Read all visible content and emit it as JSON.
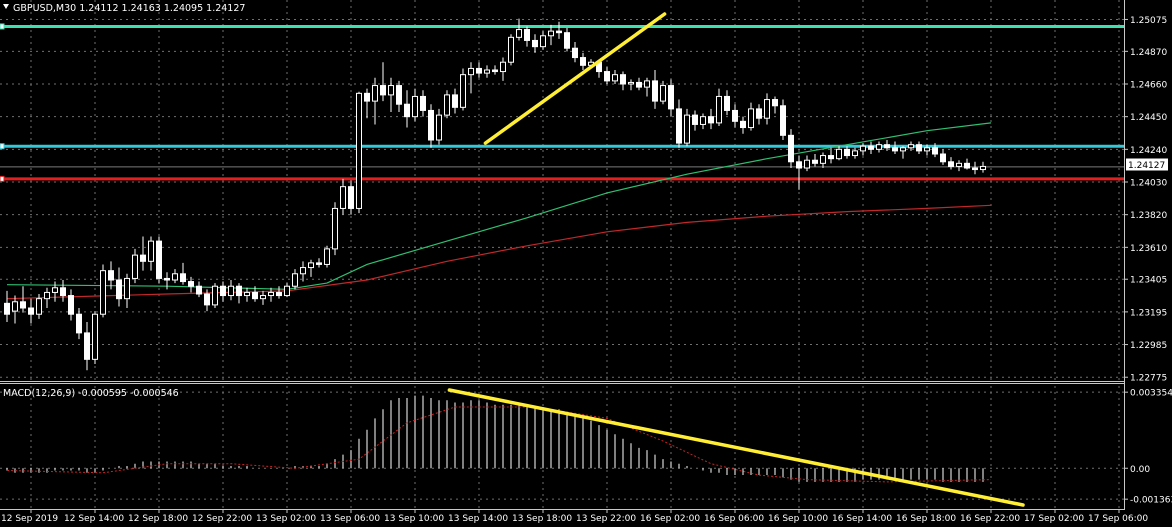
{
  "header": {
    "symbol_info": "GBPUSD,M30  1.24112 1.24163 1.24095 1.24127",
    "collapse_icon": "triangle-down-icon"
  },
  "macd": {
    "label": "MACD(12,26,9) -0.000595 -0.000546"
  },
  "colors": {
    "background": "#000000",
    "grid": "#707070",
    "bull_candle": "#000000",
    "bear_candle": "#ffffff",
    "wick": "#ffffff",
    "ma_fast": "#2fbf71",
    "ma_slow": "#c0282a",
    "level_cyan": "#35c8d8",
    "level_green": "#3fe0b0",
    "level_red": "#e02020",
    "trendline": "#ffee33",
    "macd_hist": "#ffffff",
    "macd_signal": "#d02020"
  },
  "chart_data": {
    "type": "candlestick",
    "symbol": "GBPUSD",
    "timeframe": "M30",
    "current_price": "1.24127",
    "price_axis_ticks": [
      "1.25075",
      "1.24870",
      "1.24660",
      "1.24450",
      "1.24240",
      "1.24030",
      "1.23820",
      "1.23610",
      "1.23405",
      "1.23195",
      "1.22985",
      "1.22775"
    ],
    "macd_axis_ticks": [
      "0.003354",
      "0.00",
      "-0.001363"
    ],
    "time_axis_ticks": [
      "12 Sep 2019",
      "12 Sep 14:00",
      "12 Sep 18:00",
      "12 Sep 22:00",
      "13 Sep 02:00",
      "13 Sep 06:00",
      "13 Sep 10:00",
      "13 Sep 14:00",
      "13 Sep 18:00",
      "13 Sep 22:00",
      "16 Sep 02:00",
      "16 Sep 06:00",
      "16 Sep 10:00",
      "16 Sep 14:00",
      "16 Sep 18:00",
      "16 Sep 22:00",
      "17 Sep 02:00",
      "17 Sep 06:00"
    ],
    "ylim": [
      1.2277,
      1.2511
    ],
    "macd_ylim": [
      -0.00162,
      0.00345
    ],
    "horizontal_levels": [
      {
        "price": 1.2503,
        "color_key": "level_green"
      },
      {
        "price": 1.2426,
        "color_key": "level_cyan"
      },
      {
        "price": 1.2405,
        "color_key": "level_red"
      }
    ],
    "candles": [
      [
        1.2325,
        1.2333,
        1.2313,
        1.2318
      ],
      [
        1.232,
        1.233,
        1.2312,
        1.2326
      ],
      [
        1.2326,
        1.2336,
        1.2319,
        1.2322
      ],
      [
        1.2322,
        1.2328,
        1.2312,
        1.2318
      ],
      [
        1.2318,
        1.2331,
        1.2315,
        1.2328
      ],
      [
        1.2328,
        1.2335,
        1.2322,
        1.2332
      ],
      [
        1.2332,
        1.2339,
        1.2326,
        1.2335
      ],
      [
        1.2335,
        1.234,
        1.2326,
        1.233
      ],
      [
        1.233,
        1.2334,
        1.2314,
        1.2318
      ],
      [
        1.2318,
        1.2322,
        1.2302,
        1.2306
      ],
      [
        1.2306,
        1.2313,
        1.2282,
        1.2289
      ],
      [
        1.2289,
        1.232,
        1.2286,
        1.2318
      ],
      [
        1.2318,
        1.235,
        1.2316,
        1.2346
      ],
      [
        1.2346,
        1.2352,
        1.2334,
        1.234
      ],
      [
        1.234,
        1.2348,
        1.2323,
        1.2328
      ],
      [
        1.2328,
        1.2344,
        1.2322,
        1.2341
      ],
      [
        1.2341,
        1.236,
        1.2338,
        1.2356
      ],
      [
        1.2356,
        1.2368,
        1.2346,
        1.2352
      ],
      [
        1.2352,
        1.2368,
        1.2346,
        1.2365
      ],
      [
        1.2365,
        1.2368,
        1.2338,
        1.2341
      ],
      [
        1.2341,
        1.2345,
        1.2334,
        1.234
      ],
      [
        1.234,
        1.2347,
        1.2338,
        1.2344
      ],
      [
        1.2344,
        1.2351,
        1.2337,
        1.2339
      ],
      [
        1.2339,
        1.2342,
        1.2332,
        1.2336
      ],
      [
        1.2336,
        1.2339,
        1.2329,
        1.2331
      ],
      [
        1.2331,
        1.2334,
        1.232,
        1.2324
      ],
      [
        1.2324,
        1.2338,
        1.2322,
        1.2336
      ],
      [
        1.2336,
        1.2339,
        1.2326,
        1.233
      ],
      [
        1.233,
        1.234,
        1.2327,
        1.2336
      ],
      [
        1.2336,
        1.2338,
        1.2325,
        1.233
      ],
      [
        1.233,
        1.2335,
        1.2326,
        1.2332
      ],
      [
        1.2332,
        1.2336,
        1.2326,
        1.2328
      ],
      [
        1.2328,
        1.2333,
        1.2324,
        1.233
      ],
      [
        1.233,
        1.2335,
        1.2326,
        1.2332
      ],
      [
        1.2332,
        1.2336,
        1.2328,
        1.233
      ],
      [
        1.233,
        1.2338,
        1.2329,
        1.2336
      ],
      [
        1.2336,
        1.2347,
        1.2334,
        1.2344
      ],
      [
        1.2344,
        1.2352,
        1.2339,
        1.2348
      ],
      [
        1.2348,
        1.2353,
        1.2342,
        1.2351
      ],
      [
        1.2351,
        1.2354,
        1.2348,
        1.235
      ],
      [
        1.235,
        1.2362,
        1.2348,
        1.236
      ],
      [
        1.236,
        1.239,
        1.2356,
        1.2386
      ],
      [
        1.2386,
        1.2405,
        1.2382,
        1.24
      ],
      [
        1.24,
        1.2404,
        1.2382,
        1.2386
      ],
      [
        1.2386,
        1.2461,
        1.2383,
        1.246
      ],
      [
        1.246,
        1.2463,
        1.2444,
        1.2455
      ],
      [
        1.2455,
        1.247,
        1.244,
        1.2465
      ],
      [
        1.2465,
        1.248,
        1.2455,
        1.2459
      ],
      [
        1.2459,
        1.247,
        1.2448,
        1.2465
      ],
      [
        1.2465,
        1.2468,
        1.2448,
        1.2453
      ],
      [
        1.2453,
        1.2462,
        1.2438,
        1.2445
      ],
      [
        1.2445,
        1.2463,
        1.2442,
        1.2458
      ],
      [
        1.2458,
        1.2462,
        1.2445,
        1.2449
      ],
      [
        1.2449,
        1.2453,
        1.2425,
        1.243
      ],
      [
        1.243,
        1.245,
        1.2427,
        1.2446
      ],
      [
        1.2446,
        1.2462,
        1.2444,
        1.2459
      ],
      [
        1.2459,
        1.2463,
        1.2447,
        1.2451
      ],
      [
        1.2451,
        1.2476,
        1.2449,
        1.2472
      ],
      [
        1.2472,
        1.248,
        1.246,
        1.2476
      ],
      [
        1.2476,
        1.248,
        1.247,
        1.2473
      ],
      [
        1.2473,
        1.2478,
        1.247,
        1.2475
      ],
      [
        1.2475,
        1.2478,
        1.2472,
        1.2474
      ],
      [
        1.2474,
        1.2483,
        1.2468,
        1.248
      ],
      [
        1.248,
        1.2498,
        1.2478,
        1.2496
      ],
      [
        1.2496,
        1.2508,
        1.2494,
        1.2501
      ],
      [
        1.2501,
        1.2503,
        1.249,
        1.2494
      ],
      [
        1.2494,
        1.2498,
        1.2486,
        1.249
      ],
      [
        1.249,
        1.25,
        1.2488,
        1.2497
      ],
      [
        1.2497,
        1.2504,
        1.2491,
        1.25
      ],
      [
        1.25,
        1.2506,
        1.2495,
        1.2499
      ],
      [
        1.2499,
        1.2502,
        1.2487,
        1.2489
      ],
      [
        1.2489,
        1.2493,
        1.248,
        1.2483
      ],
      [
        1.2483,
        1.2486,
        1.2475,
        1.2478
      ],
      [
        1.2478,
        1.2482,
        1.2476,
        1.248
      ],
      [
        1.248,
        1.2481,
        1.247,
        1.2474
      ],
      [
        1.2474,
        1.2477,
        1.2466,
        1.2468
      ],
      [
        1.2468,
        1.2475,
        1.2466,
        1.2472
      ],
      [
        1.2472,
        1.2474,
        1.2462,
        1.2466
      ],
      [
        1.2466,
        1.2469,
        1.2462,
        1.2467
      ],
      [
        1.2467,
        1.247,
        1.2462,
        1.2464
      ],
      [
        1.2464,
        1.247,
        1.2458,
        1.2468
      ],
      [
        1.2468,
        1.2475,
        1.245,
        1.2455
      ],
      [
        1.2455,
        1.2468,
        1.2453,
        1.2465
      ],
      [
        1.2465,
        1.2469,
        1.2445,
        1.245
      ],
      [
        1.245,
        1.2456,
        1.2425,
        1.2428
      ],
      [
        1.2428,
        1.245,
        1.2426,
        1.2446
      ],
      [
        1.2446,
        1.2449,
        1.2436,
        1.244
      ],
      [
        1.244,
        1.2447,
        1.2437,
        1.2445
      ],
      [
        1.2445,
        1.245,
        1.2437,
        1.2441
      ],
      [
        1.2441,
        1.2463,
        1.2439,
        1.2458
      ],
      [
        1.2458,
        1.2462,
        1.2446,
        1.2449
      ],
      [
        1.2449,
        1.2453,
        1.2438,
        1.2442
      ],
      [
        1.2442,
        1.2445,
        1.2434,
        1.2438
      ],
      [
        1.2438,
        1.2454,
        1.2436,
        1.245
      ],
      [
        1.245,
        1.2453,
        1.244,
        1.2444
      ],
      [
        1.2444,
        1.246,
        1.244,
        1.2456
      ],
      [
        1.2456,
        1.2458,
        1.2447,
        1.2452
      ],
      [
        1.2452,
        1.2456,
        1.243,
        1.2433
      ],
      [
        1.2433,
        1.2437,
        1.2412,
        1.2416
      ],
      [
        1.2416,
        1.242,
        1.2398,
        1.2412
      ],
      [
        1.2412,
        1.242,
        1.241,
        1.2417
      ],
      [
        1.2417,
        1.2421,
        1.2413,
        1.2415
      ],
      [
        1.2415,
        1.2422,
        1.2412,
        1.242
      ],
      [
        1.242,
        1.2425,
        1.2415,
        1.2418
      ],
      [
        1.2418,
        1.2426,
        1.2417,
        1.2424
      ],
      [
        1.2424,
        1.2426,
        1.2418,
        1.242
      ],
      [
        1.242,
        1.2425,
        1.2418,
        1.2423
      ],
      [
        1.2423,
        1.2428,
        1.242,
        1.2426
      ],
      [
        1.2426,
        1.2429,
        1.2421,
        1.2424
      ],
      [
        1.2424,
        1.2429,
        1.2422,
        1.2427
      ],
      [
        1.2427,
        1.243,
        1.2423,
        1.2425
      ],
      [
        1.2425,
        1.2429,
        1.2421,
        1.2423
      ],
      [
        1.2423,
        1.2426,
        1.2418,
        1.2425
      ],
      [
        1.2425,
        1.2429,
        1.2423,
        1.2427
      ],
      [
        1.2427,
        1.2429,
        1.2421,
        1.2423
      ],
      [
        1.2423,
        1.2427,
        1.242,
        1.2425
      ],
      [
        1.2425,
        1.2428,
        1.2419,
        1.2421
      ],
      [
        1.2421,
        1.2424,
        1.2414,
        1.2416
      ],
      [
        1.2416,
        1.2419,
        1.2411,
        1.2413
      ],
      [
        1.2413,
        1.2417,
        1.241,
        1.2415
      ],
      [
        1.2415,
        1.2418,
        1.2411,
        1.2412
      ],
      [
        1.2412,
        1.2416,
        1.2408,
        1.2411
      ],
      [
        1.2411,
        1.2416,
        1.2409,
        1.2413
      ]
    ],
    "ma_fast": [
      [
        0,
        1.2337
      ],
      [
        20,
        1.2336
      ],
      [
        35,
        1.2334
      ],
      [
        40,
        1.2338
      ],
      [
        45,
        1.235
      ],
      [
        55,
        1.2365
      ],
      [
        65,
        1.238
      ],
      [
        75,
        1.2396
      ],
      [
        85,
        1.2408
      ],
      [
        95,
        1.2418
      ],
      [
        105,
        1.2427
      ],
      [
        115,
        1.2436
      ],
      [
        123,
        1.2441
      ]
    ],
    "ma_slow": [
      [
        0,
        1.2328
      ],
      [
        20,
        1.2331
      ],
      [
        35,
        1.2333
      ],
      [
        45,
        1.234
      ],
      [
        55,
        1.2352
      ],
      [
        65,
        1.2362
      ],
      [
        75,
        1.2371
      ],
      [
        85,
        1.2377
      ],
      [
        95,
        1.2381
      ],
      [
        105,
        1.2384
      ],
      [
        115,
        1.2386
      ],
      [
        123,
        1.2388
      ]
    ],
    "trendlines": [
      {
        "x1": 59.8,
        "y1": 1.2428,
        "x2": 82.2,
        "y2": 1.2511
      },
      {
        "macd": true,
        "x1": 55.3,
        "y1": 0.00345,
        "x2": 127,
        "y2": -0.00162
      }
    ],
    "macd_hist": [
      -0.0001,
      -0.0002,
      -0.0002,
      -0.0002,
      -0.0002,
      -0.0002,
      -0.0001,
      -0.0001,
      -0.0001,
      -0.0001,
      -0.0002,
      -0.0002,
      -0.0001,
      0.0,
      0.0001,
      0.0001,
      0.0002,
      0.0003,
      0.0003,
      0.0003,
      0.0003,
      0.0003,
      0.0003,
      0.0003,
      0.0002,
      0.0002,
      0.0002,
      0.0001,
      0.0001,
      0.0001,
      0.0001,
      0.0,
      0.0,
      0.0,
      0.0,
      0.0,
      0.0001,
      0.0001,
      0.0001,
      0.0001,
      0.0002,
      0.0004,
      0.0006,
      0.0008,
      0.0013,
      0.0017,
      0.0022,
      0.0026,
      0.003,
      0.0031,
      0.0031,
      0.0032,
      0.0032,
      0.0031,
      0.003,
      0.003,
      0.0029,
      0.0029,
      0.003,
      0.003,
      0.0029,
      0.0028,
      0.0028,
      0.0028,
      0.0029,
      0.0028,
      0.0027,
      0.0027,
      0.0026,
      0.0026,
      0.0025,
      0.0024,
      0.0022,
      0.0021,
      0.0019,
      0.0017,
      0.0015,
      0.0013,
      0.0011,
      0.0009,
      0.0008,
      0.0006,
      0.0004,
      0.0003,
      0.0002,
      0.0001,
      0.0,
      -0.0001,
      -0.0002,
      -0.0002,
      -0.0003,
      -0.0003,
      -0.0003,
      -0.0003,
      -0.0003,
      -0.0003,
      -0.0003,
      -0.0004,
      -0.0005,
      -0.0006,
      -0.0006,
      -0.0006,
      -0.0006,
      -0.0006,
      -0.0006,
      -0.0006,
      -0.0006,
      -0.0005,
      -0.0005,
      -0.0005,
      -0.0005,
      -0.0005,
      -0.0005,
      -0.0005,
      -0.0005,
      -0.0005,
      -0.0005,
      -0.0006,
      -0.0006,
      -0.0006,
      -0.0006,
      -0.0006,
      -0.0006
    ],
    "macd_signal": [
      [
        0,
        -0.0001
      ],
      [
        12,
        -0.0002
      ],
      [
        20,
        0.0002
      ],
      [
        28,
        0.0002
      ],
      [
        36,
        0.0
      ],
      [
        44,
        0.0004
      ],
      [
        50,
        0.002
      ],
      [
        56,
        0.0027
      ],
      [
        66,
        0.0027
      ],
      [
        75,
        0.0022
      ],
      [
        82,
        0.0012
      ],
      [
        88,
        0.0002
      ],
      [
        94,
        -0.0003
      ],
      [
        100,
        -0.0005
      ],
      [
        110,
        -0.0006
      ],
      [
        123,
        -0.0005
      ]
    ]
  }
}
